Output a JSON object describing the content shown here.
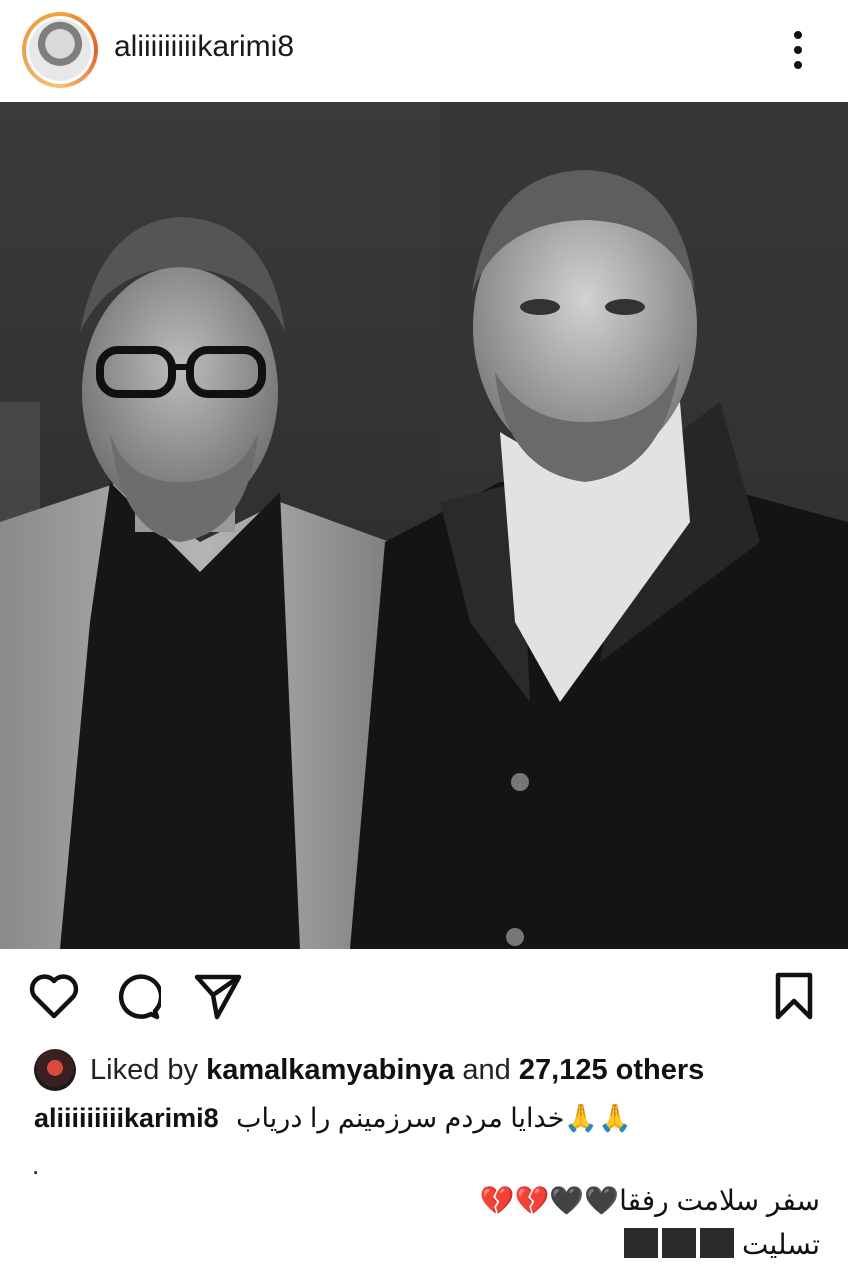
{
  "header": {
    "username": "aliiiiiiiiikarimi8",
    "avatar_icon": "profile-avatar",
    "more_icon": "more-vertical-icon"
  },
  "photo": {
    "description_icon": "post-photo"
  },
  "actions": {
    "like_icon": "heart-outline-icon",
    "comment_icon": "comment-icon",
    "share_icon": "send-icon",
    "save_icon": "bookmark-icon"
  },
  "likes": {
    "prefix": "Liked by",
    "user": "kamalkamyabinya",
    "middle": "and",
    "count": "27,125 others"
  },
  "caption": {
    "user": "aliiiiiiiiikarimi8",
    "text": "خدایا مردم سرزمینم را دریاب🙏🙏",
    "dot": ".",
    "line1": "سفر سلامت رفقا🖤🖤💔💔",
    "line2": "تسلیت"
  },
  "colors": {
    "text": "#111111",
    "background": "#ffffff",
    "avatar_ring": "#e0622a"
  }
}
